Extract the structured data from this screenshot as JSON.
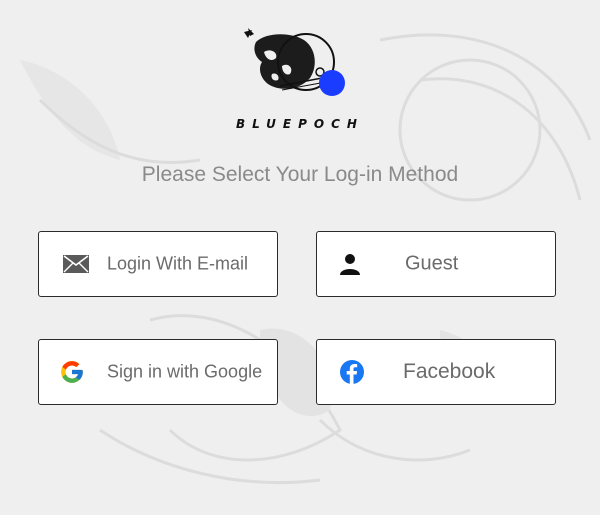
{
  "brand": {
    "name": "BLUEPOCH"
  },
  "prompt": "Please Select Your Log-in Method",
  "buttons": {
    "email": "Login With E-mail",
    "guest": "Guest",
    "google": "Sign in with Google",
    "facebook": "Facebook"
  },
  "icons": {
    "email": "mail-icon",
    "guest": "person-icon",
    "google": "google-icon",
    "facebook": "facebook-icon"
  },
  "colors": {
    "background": "#efefef",
    "button_bg": "#ffffff",
    "button_border": "#2b2b2b",
    "button_text": "#6b6b6b",
    "prompt_text": "#8a8a8a",
    "brand_blue": "#1a3cff",
    "facebook_blue": "#1877f2"
  }
}
